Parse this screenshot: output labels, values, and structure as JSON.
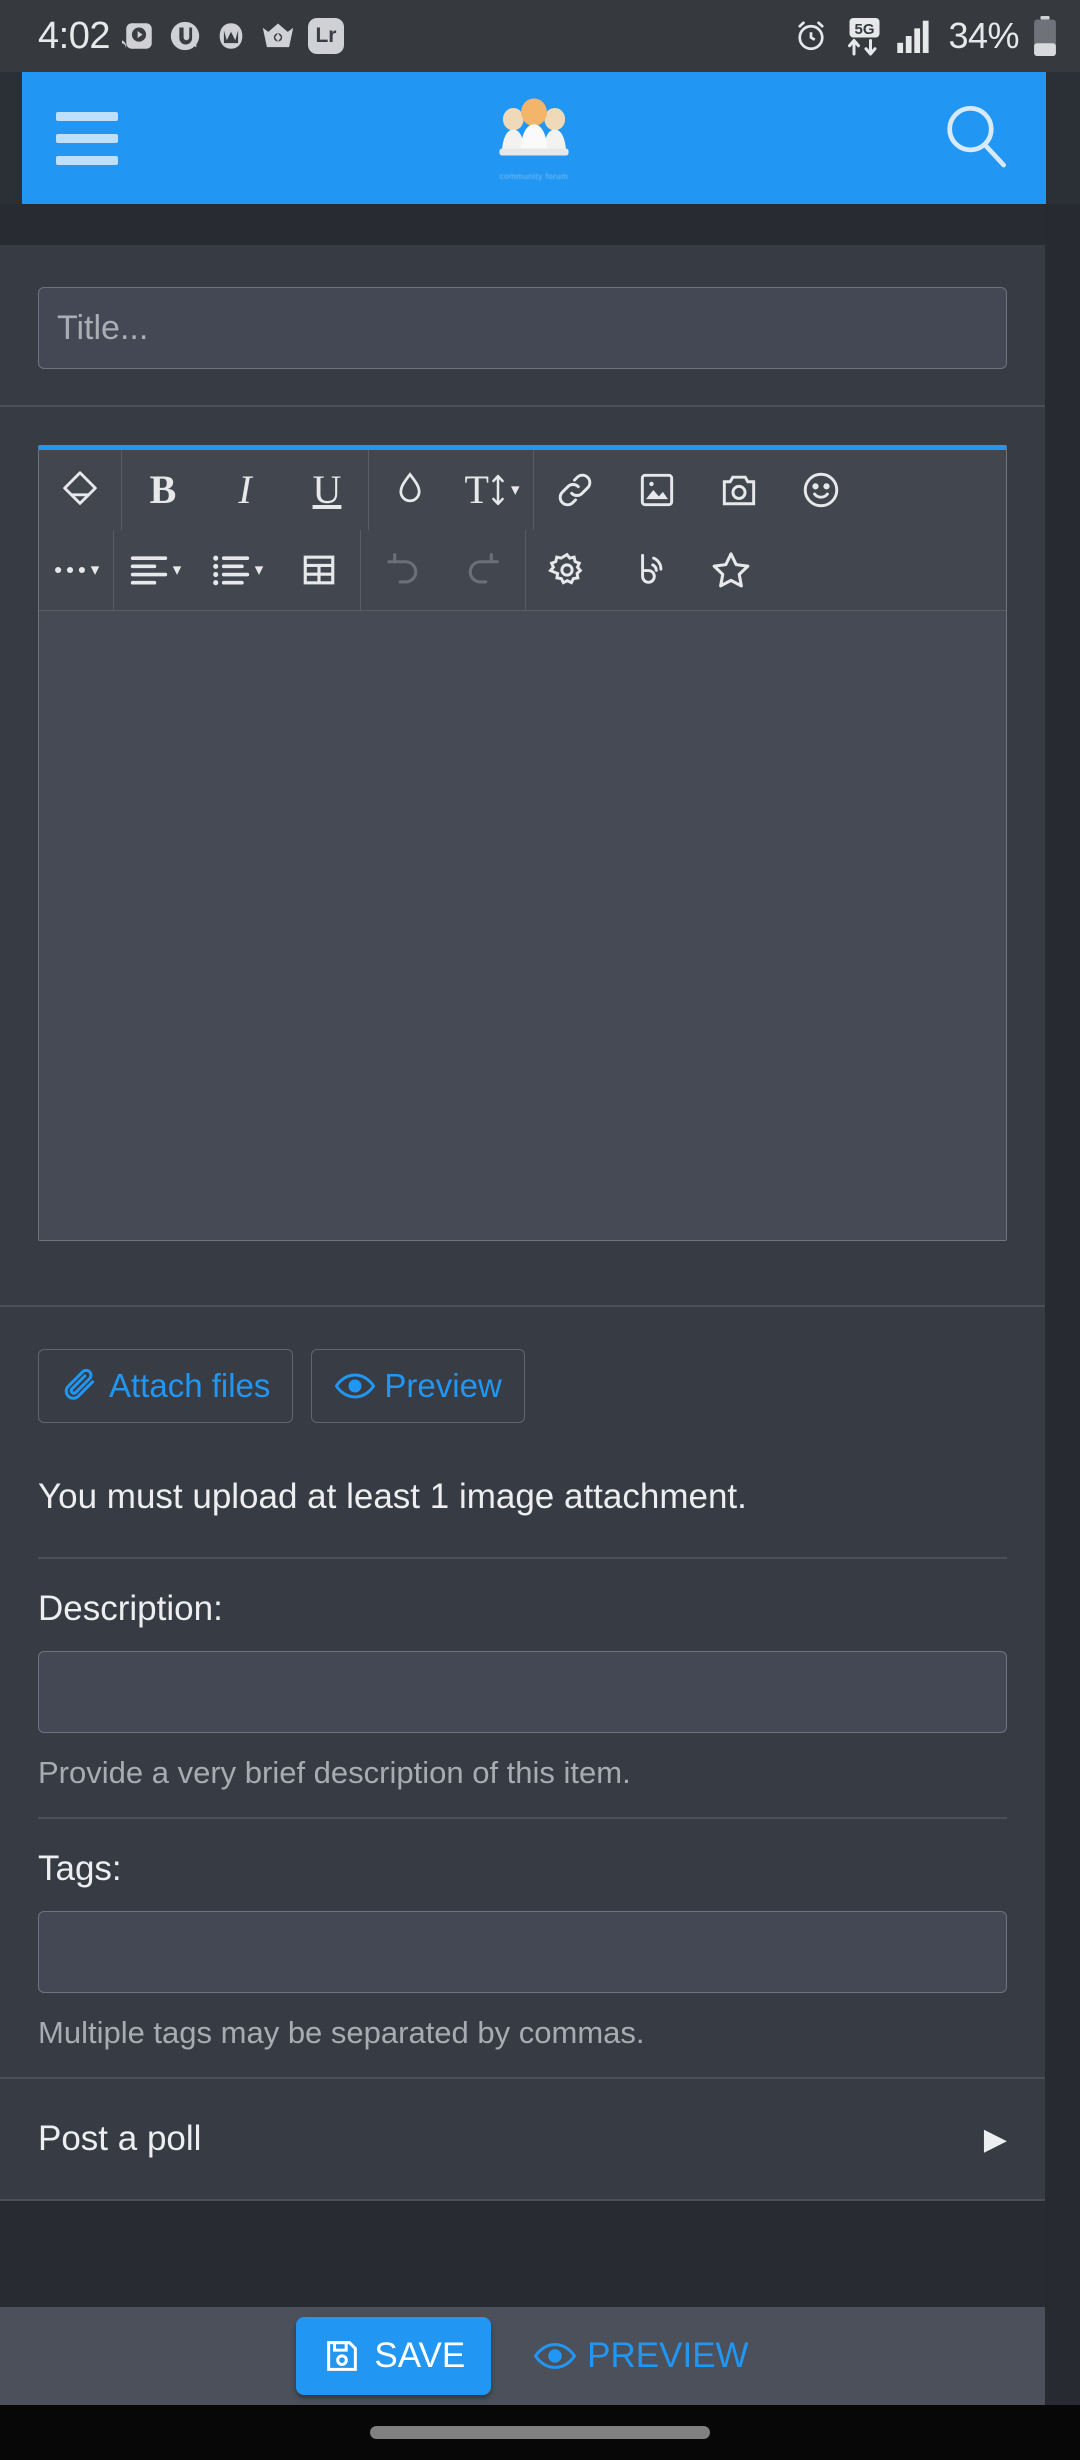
{
  "statusbar": {
    "time": "4:02",
    "battery_percent": "34%",
    "notification_icons": [
      "cast-podcast-icon",
      "utorrent-icon",
      "malwarebytes-icon",
      "crown-app-icon",
      "lightroom-icon"
    ],
    "lightroom_label": "Lr",
    "right_icons": [
      "alarm-clock-icon",
      "5g-network-icon",
      "signal-bars-icon",
      "battery-icon"
    ],
    "network_label": "5G"
  },
  "appbar": {
    "menu_icon": "hamburger-menu-icon",
    "logo_icon": "community-logo-icon",
    "logo_subtext": "community forum",
    "search_icon": "search-icon",
    "background_color": "#2196f3"
  },
  "form": {
    "title_placeholder": "Title...",
    "title_value": ""
  },
  "editor": {
    "toolbar_row1": [
      {
        "name": "clear-formatting-icon",
        "glyph": "eraser",
        "label": "",
        "caret": false,
        "dim": false
      },
      {
        "name": "bold-button",
        "glyph": "text",
        "label": "B",
        "style": "bold",
        "caret": false,
        "dim": false
      },
      {
        "name": "italic-button",
        "glyph": "text",
        "label": "I",
        "style": "ital",
        "caret": false,
        "dim": false
      },
      {
        "name": "underline-button",
        "glyph": "text",
        "label": "U",
        "style": "und",
        "caret": false,
        "dim": false
      },
      {
        "name": "text-color-icon",
        "glyph": "droplet",
        "label": "",
        "caret": false,
        "dim": false
      },
      {
        "name": "font-size-button",
        "glyph": "font-size",
        "label": "",
        "caret": true,
        "dim": false
      },
      {
        "name": "insert-link-icon",
        "glyph": "link",
        "label": "",
        "caret": false,
        "dim": false
      },
      {
        "name": "insert-image-icon",
        "glyph": "image",
        "label": "",
        "caret": false,
        "dim": false
      },
      {
        "name": "camera-icon",
        "glyph": "camera",
        "label": "",
        "caret": false,
        "dim": false
      },
      {
        "name": "emoji-icon",
        "glyph": "smiley",
        "label": "",
        "caret": false,
        "dim": false
      }
    ],
    "toolbar_row2": [
      {
        "name": "more-options-button",
        "glyph": "ellipsis",
        "label": "",
        "caret": true,
        "dim": false
      },
      {
        "name": "text-align-button",
        "glyph": "align",
        "label": "",
        "caret": true,
        "dim": false
      },
      {
        "name": "list-button",
        "glyph": "list",
        "label": "",
        "caret": true,
        "dim": false
      },
      {
        "name": "insert-table-icon",
        "glyph": "table",
        "label": "",
        "caret": false,
        "dim": false
      },
      {
        "name": "undo-button",
        "glyph": "undo",
        "label": "",
        "caret": false,
        "dim": true
      },
      {
        "name": "redo-button",
        "glyph": "redo",
        "label": "",
        "caret": false,
        "dim": true
      },
      {
        "name": "editor-settings-icon",
        "glyph": "gear",
        "label": "",
        "caret": false,
        "dim": false
      },
      {
        "name": "broadcast-icon",
        "glyph": "broadcast",
        "label": "",
        "caret": false,
        "dim": false
      },
      {
        "name": "favorite-star-icon",
        "glyph": "star",
        "label": "",
        "caret": false,
        "dim": false
      }
    ],
    "body_value": ""
  },
  "actions": {
    "attach_label": "Attach files",
    "attach_icon": "paperclip-icon",
    "preview_label": "Preview",
    "preview_icon": "eye-icon"
  },
  "notice": {
    "text": "You must upload at least 1 image attachment."
  },
  "fields": [
    {
      "label": "Description:",
      "value": "",
      "placeholder": "",
      "hint": "Provide a very brief description of this item."
    },
    {
      "label": "Tags:",
      "value": "",
      "placeholder": "",
      "hint": "Multiple tags may be separated by commas."
    }
  ],
  "poll": {
    "label": "Post a poll",
    "chevron_icon": "chevron-right-icon"
  },
  "bottombar": {
    "save_label": "SAVE",
    "save_icon": "floppy-disk-icon",
    "preview_label": "PREVIEW",
    "preview_icon": "eye-icon",
    "accent_color": "#2196f3"
  },
  "navbar": {
    "pill": "gesture-nav-pill"
  }
}
